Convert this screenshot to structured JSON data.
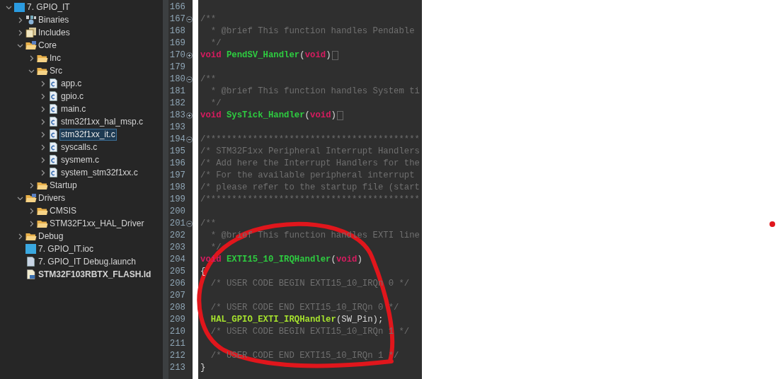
{
  "explorer": {
    "items": [
      {
        "label": "7. GPIO_IT",
        "kind": "project",
        "expanded": true,
        "selected": false,
        "children": [
          {
            "label": "Binaries",
            "kind": "binaries",
            "expanded": false,
            "selected": false
          },
          {
            "label": "Includes",
            "kind": "includes",
            "expanded": false,
            "selected": false
          },
          {
            "label": "Core",
            "kind": "source-folder",
            "expanded": true,
            "selected": false,
            "children": [
              {
                "label": "Inc",
                "kind": "folder",
                "expanded": false,
                "selected": false
              },
              {
                "label": "Src",
                "kind": "folder",
                "expanded": true,
                "selected": false,
                "children": [
                  {
                    "label": "app.c",
                    "kind": "c-file",
                    "expanded": false,
                    "selected": false
                  },
                  {
                    "label": "gpio.c",
                    "kind": "c-file",
                    "expanded": false,
                    "selected": false
                  },
                  {
                    "label": "main.c",
                    "kind": "c-file",
                    "expanded": false,
                    "selected": false
                  },
                  {
                    "label": "stm32f1xx_hal_msp.c",
                    "kind": "c-file",
                    "expanded": false,
                    "selected": false
                  },
                  {
                    "label": "stm32f1xx_it.c",
                    "kind": "c-file",
                    "expanded": false,
                    "selected": true
                  },
                  {
                    "label": "syscalls.c",
                    "kind": "c-file",
                    "expanded": false,
                    "selected": false
                  },
                  {
                    "label": "sysmem.c",
                    "kind": "c-file",
                    "expanded": false,
                    "selected": false
                  },
                  {
                    "label": "system_stm32f1xx.c",
                    "kind": "c-file",
                    "expanded": false,
                    "selected": false
                  }
                ]
              },
              {
                "label": "Startup",
                "kind": "folder",
                "expanded": false,
                "selected": false
              }
            ]
          },
          {
            "label": "Drivers",
            "kind": "source-folder",
            "expanded": true,
            "selected": false,
            "children": [
              {
                "label": "CMSIS",
                "kind": "folder",
                "expanded": false,
                "selected": false
              },
              {
                "label": "STM32F1xx_HAL_Driver",
                "kind": "folder",
                "expanded": false,
                "selected": false
              }
            ]
          },
          {
            "label": "Debug",
            "kind": "folder",
            "expanded": false,
            "selected": false
          },
          {
            "label": "7. GPIO_IT.ioc",
            "kind": "mx-file",
            "selected": false
          },
          {
            "label": "7. GPIO_IT Debug.launch",
            "kind": "launch-file",
            "selected": false
          },
          {
            "label": "STM32F103RBTX_FLASH.ld",
            "kind": "ld-file",
            "selected": false
          }
        ]
      }
    ]
  },
  "editor": {
    "lines": [
      {
        "number": "166"
      },
      {
        "number": "167",
        "collapsed": false,
        "tokens": [
          {
            "kind": "comment",
            "text": "/**"
          }
        ]
      },
      {
        "number": "168",
        "tokens": [
          {
            "kind": "comment",
            "text": "  * @brief This function handles Pendable"
          }
        ]
      },
      {
        "number": "169",
        "tokens": [
          {
            "kind": "comment",
            "text": "  */"
          }
        ]
      },
      {
        "number": "170",
        "collapsed": true,
        "tokens": [
          {
            "kind": "keyword",
            "text": "void"
          },
          {
            "kind": "function",
            "text": " PendSV_Handler"
          },
          {
            "kind": "plain",
            "text": "("
          },
          {
            "kind": "keyword",
            "text": "void"
          },
          {
            "kind": "plain",
            "text": ")"
          }
        ]
      },
      {
        "number": "179"
      },
      {
        "number": "180",
        "collapsed": false,
        "tokens": [
          {
            "kind": "comment",
            "text": "/**"
          }
        ]
      },
      {
        "number": "181",
        "tokens": [
          {
            "kind": "comment",
            "text": "  * @brief This function handles System ti"
          }
        ]
      },
      {
        "number": "182",
        "tokens": [
          {
            "kind": "comment",
            "text": "  */"
          }
        ]
      },
      {
        "number": "183",
        "collapsed": true,
        "tokens": [
          {
            "kind": "keyword",
            "text": "void"
          },
          {
            "kind": "function",
            "text": " SysTick_Handler"
          },
          {
            "kind": "plain",
            "text": "("
          },
          {
            "kind": "keyword",
            "text": "void"
          },
          {
            "kind": "plain",
            "text": ")"
          }
        ]
      },
      {
        "number": "193"
      },
      {
        "number": "194",
        "collapsed": false,
        "tokens": [
          {
            "kind": "comment",
            "text": "/*****************************************"
          }
        ]
      },
      {
        "number": "195",
        "tokens": [
          {
            "kind": "comment",
            "text": "/* STM32F1xx Peripheral Interrupt Handlers"
          }
        ]
      },
      {
        "number": "196",
        "tokens": [
          {
            "kind": "comment",
            "text": "/* Add here the Interrupt Handlers for the"
          }
        ]
      },
      {
        "number": "197",
        "tokens": [
          {
            "kind": "comment",
            "text": "/* For the available peripheral interrupt"
          }
        ]
      },
      {
        "number": "198",
        "tokens": [
          {
            "kind": "comment",
            "text": "/* please refer to the startup file (start"
          }
        ]
      },
      {
        "number": "199",
        "tokens": [
          {
            "kind": "comment",
            "text": "/*****************************************"
          }
        ]
      },
      {
        "number": "200"
      },
      {
        "number": "201",
        "collapsed": false,
        "tokens": [
          {
            "kind": "comment",
            "text": "/**"
          }
        ]
      },
      {
        "number": "202",
        "tokens": [
          {
            "kind": "comment",
            "text": "  * @brief This function handles EXTI line"
          }
        ]
      },
      {
        "number": "203",
        "tokens": [
          {
            "kind": "comment",
            "text": "  */"
          }
        ]
      },
      {
        "number": "204",
        "tokens": [
          {
            "kind": "keyword",
            "text": "void"
          },
          {
            "kind": "function",
            "text": " EXTI15_10_IRQHandler"
          },
          {
            "kind": "plain",
            "text": "("
          },
          {
            "kind": "keyword",
            "text": "void"
          },
          {
            "kind": "plain",
            "text": ")"
          }
        ]
      },
      {
        "number": "205",
        "tokens": [
          {
            "kind": "plain",
            "text": "{"
          }
        ]
      },
      {
        "number": "206",
        "tokens": [
          {
            "kind": "comment",
            "text": "  /* USER CODE BEGIN EXTI15_10_IRQn 0 */"
          }
        ]
      },
      {
        "number": "207"
      },
      {
        "number": "208",
        "tokens": [
          {
            "kind": "comment",
            "text": "  /* USER CODE END EXTI15_10_IRQn 0 */"
          }
        ]
      },
      {
        "number": "209",
        "tokens": [
          {
            "kind": "call",
            "text": "  HAL_GPIO_EXTI_IRQHandler"
          },
          {
            "kind": "plain",
            "text": "(SW_Pin);"
          }
        ]
      },
      {
        "number": "210",
        "tokens": [
          {
            "kind": "comment",
            "text": "  /* USER CODE BEGIN EXTI15_10_IRQn 1 */"
          }
        ]
      },
      {
        "number": "211"
      },
      {
        "number": "212",
        "tokens": [
          {
            "kind": "comment",
            "text": "  /* USER CODE END EXTI15_10_IRQn 1 */"
          }
        ]
      },
      {
        "number": "213",
        "tokens": [
          {
            "kind": "plain",
            "text": "}"
          }
        ]
      }
    ]
  }
}
